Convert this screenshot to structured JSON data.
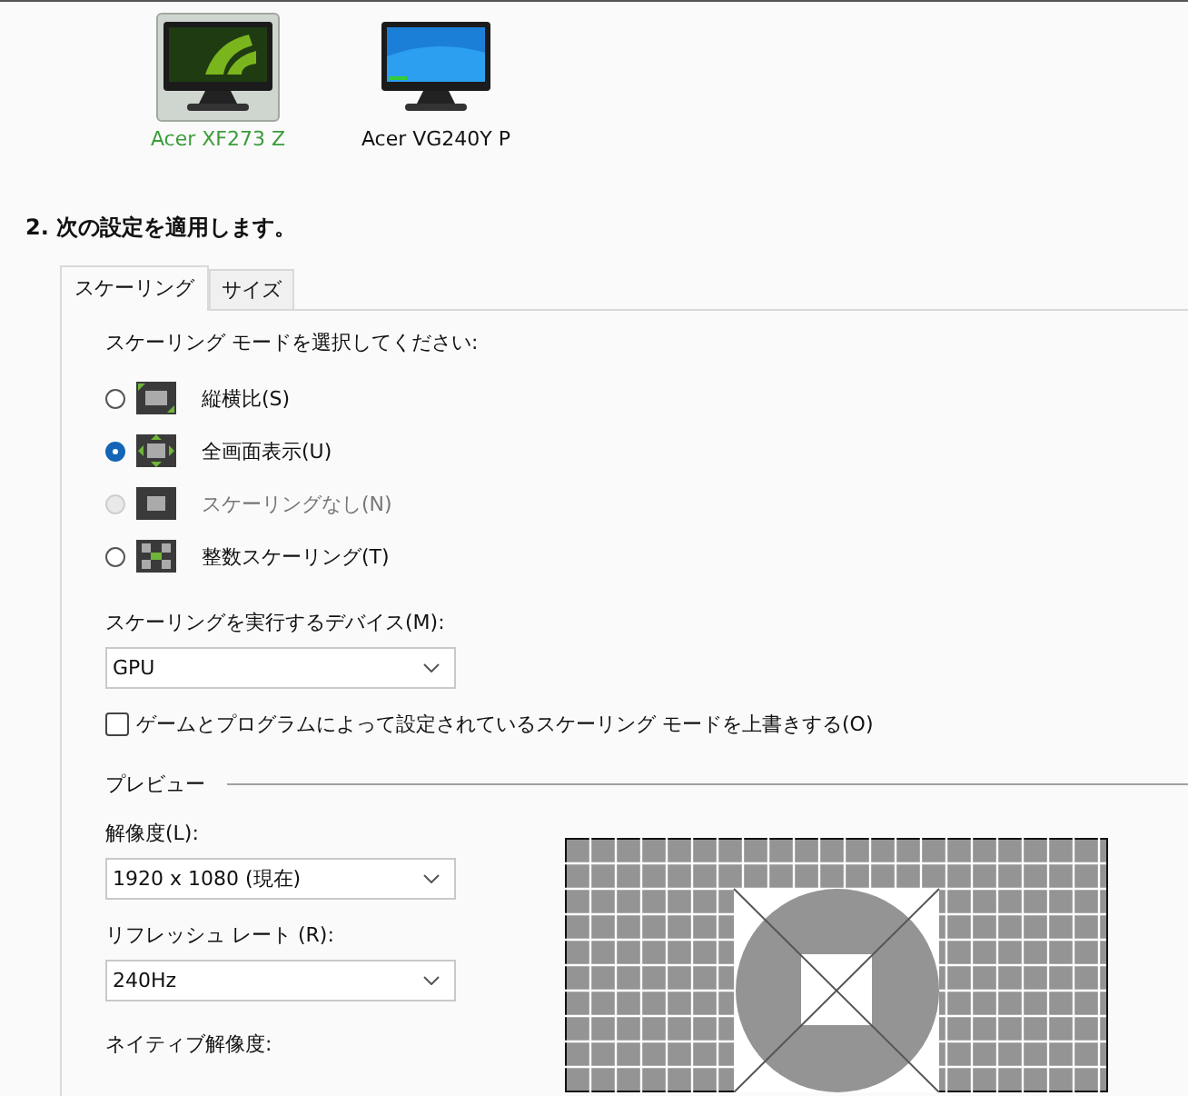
{
  "displays": [
    {
      "label": "Acer XF273 Z",
      "kind": "green",
      "selected": true
    },
    {
      "label": "Acer VG240Y P",
      "kind": "blue",
      "selected": false
    }
  ],
  "step_heading": "2. 次の設定を適用します。",
  "tabs": [
    {
      "label": "スケーリング",
      "selected": true
    },
    {
      "label": "サイズ",
      "selected": false
    }
  ],
  "scaling_prompt": "スケーリング モードを選択してください:",
  "scaling_modes": [
    {
      "label": "縦横比(S)",
      "kind": "aspect",
      "selected": false,
      "disabled": false
    },
    {
      "label": "全画面表示(U)",
      "kind": "fullscreen",
      "selected": true,
      "disabled": false
    },
    {
      "label": "スケーリングなし(N)",
      "kind": "none",
      "selected": false,
      "disabled": true
    },
    {
      "label": "整数スケーリング(T)",
      "kind": "integer",
      "selected": false,
      "disabled": false
    }
  ],
  "device_label": "スケーリングを実行するデバイス(M):",
  "device_select": {
    "value": "GPU"
  },
  "override": {
    "label": "ゲームとプログラムによって設定されているスケーリング モードを上書きする(O)",
    "checked": false
  },
  "preview": {
    "title": "プレビュー",
    "resolution_label": "解像度(L):",
    "resolution_select": {
      "value": "1920 x 1080 (現在)"
    },
    "refresh_label": "リフレッシュ レート (R):",
    "refresh_select": {
      "value": "240Hz"
    },
    "native_label": "ネイティブ解像度:"
  }
}
